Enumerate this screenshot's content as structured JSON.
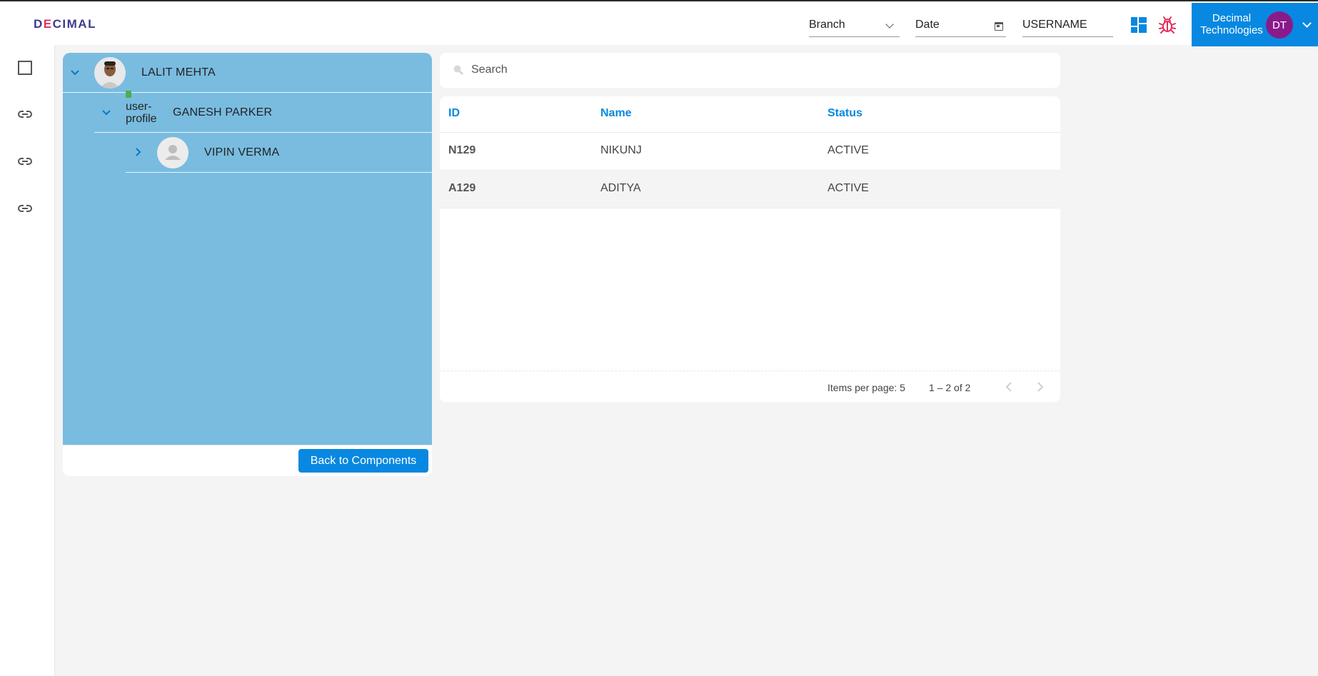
{
  "header": {
    "logo": {
      "pre": "D",
      "accent": "E",
      "post": "CIMAL"
    },
    "branch_label": "Branch",
    "date_label": "Date",
    "username_label": "USERNAME",
    "account": {
      "line1": "Decimal",
      "line2": "Technologies",
      "initials": "DT"
    }
  },
  "sidebar": {
    "items": [
      "checkbox-icon",
      "link-icon",
      "link-icon",
      "link-icon"
    ]
  },
  "tree": {
    "nodes": [
      {
        "name": "LALIT MEHTA",
        "expanded": true,
        "avatar": "photo"
      },
      {
        "name": "GANESH PARKER",
        "expanded": true,
        "avatar": "broken-image",
        "alt_text": "user-profile"
      },
      {
        "name": "VIPIN VERMA",
        "expanded": false,
        "avatar": "placeholder"
      }
    ],
    "back_button": "Back to Components"
  },
  "search": {
    "placeholder": "Search"
  },
  "table": {
    "columns": [
      "ID",
      "Name",
      "Status"
    ],
    "rows": [
      {
        "id": "N129",
        "name": "NIKUNJ",
        "status": "ACTIVE"
      },
      {
        "id": "A129",
        "name": "ADITYA",
        "status": "ACTIVE"
      }
    ],
    "paginator": {
      "items_per_page": "Items per page: 5",
      "range": "1 – 2 of 2"
    }
  },
  "colors": {
    "primary": "#0888e0",
    "tree_bg": "#79bce0",
    "avatar_dt": "#8a1a8a",
    "bug": "#e0305d"
  }
}
